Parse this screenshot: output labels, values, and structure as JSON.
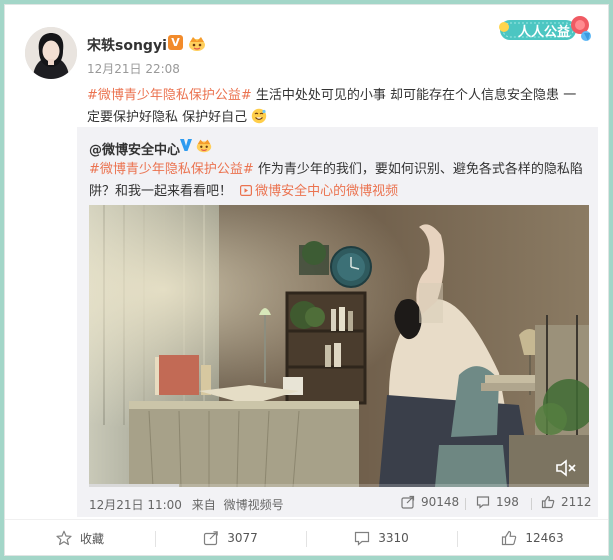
{
  "post": {
    "username": "宋轶songyi",
    "verified_badge": "V",
    "time": "12月21日 22:08",
    "hashtag": "#微博青少年隐私保护公益#",
    "text": " 生活中处处可见的小事 却可能存在个人信息安全隐患 一定要保护好隐私 保护好自己",
    "emoji": "smiling-face-icon"
  },
  "badge": {
    "renren_label": "人人公益"
  },
  "repost": {
    "username": "@微博安全中心",
    "hashtag": "#微博青少年隐私保护公益#",
    "text": " 作为青少年的我们，要如何识别、避免各式各样的隐私陷阱？和我一起来看看吧！",
    "video_link_text": "微博安全中心的微博视频",
    "video_progress": 0.18,
    "time": "12月21日 11:00",
    "source_prefix": "来自",
    "source": "微博视频号",
    "reposts": "90148",
    "comments": "198",
    "likes": "2112"
  },
  "actions": {
    "favorite_label": "收藏",
    "repost_count": "3077",
    "comment_count": "3310",
    "like_count": "12463"
  },
  "colors": {
    "accent": "#eb7350",
    "background": "#a3d6c8",
    "repost_bg": "#f2f2f5"
  }
}
